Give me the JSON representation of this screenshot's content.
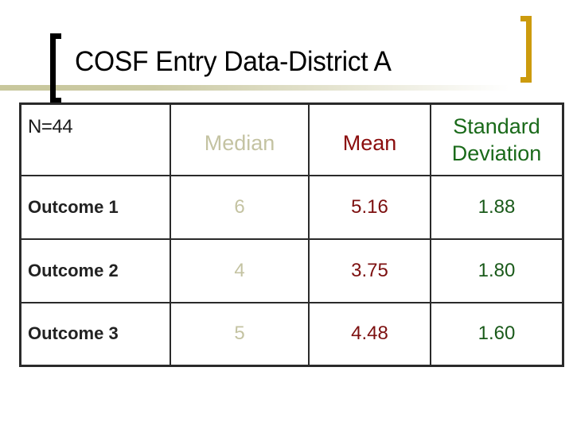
{
  "slide": {
    "title": "COSF Entry Data-District A"
  },
  "colors": {
    "left_bracket": "#000000",
    "right_bracket": "#cc9b0e",
    "title_rule": "#c8c79c",
    "median_text": "#c4c3a2",
    "mean_text": "#8b0d0d",
    "sd_text": "#1a6a1a"
  },
  "table": {
    "corner_label": "N=44",
    "headers": {
      "median": "Median",
      "mean": "Mean",
      "sd_line1": "Standard",
      "sd_line2": "Deviation"
    },
    "rows": [
      {
        "label": "Outcome 1",
        "median": "6",
        "mean": "5.16",
        "sd": "1.88"
      },
      {
        "label": "Outcome 2",
        "median": "4",
        "mean": "3.75",
        "sd": "1.80"
      },
      {
        "label": "Outcome 3",
        "median": "5",
        "mean": "4.48",
        "sd": "1.60"
      }
    ]
  }
}
